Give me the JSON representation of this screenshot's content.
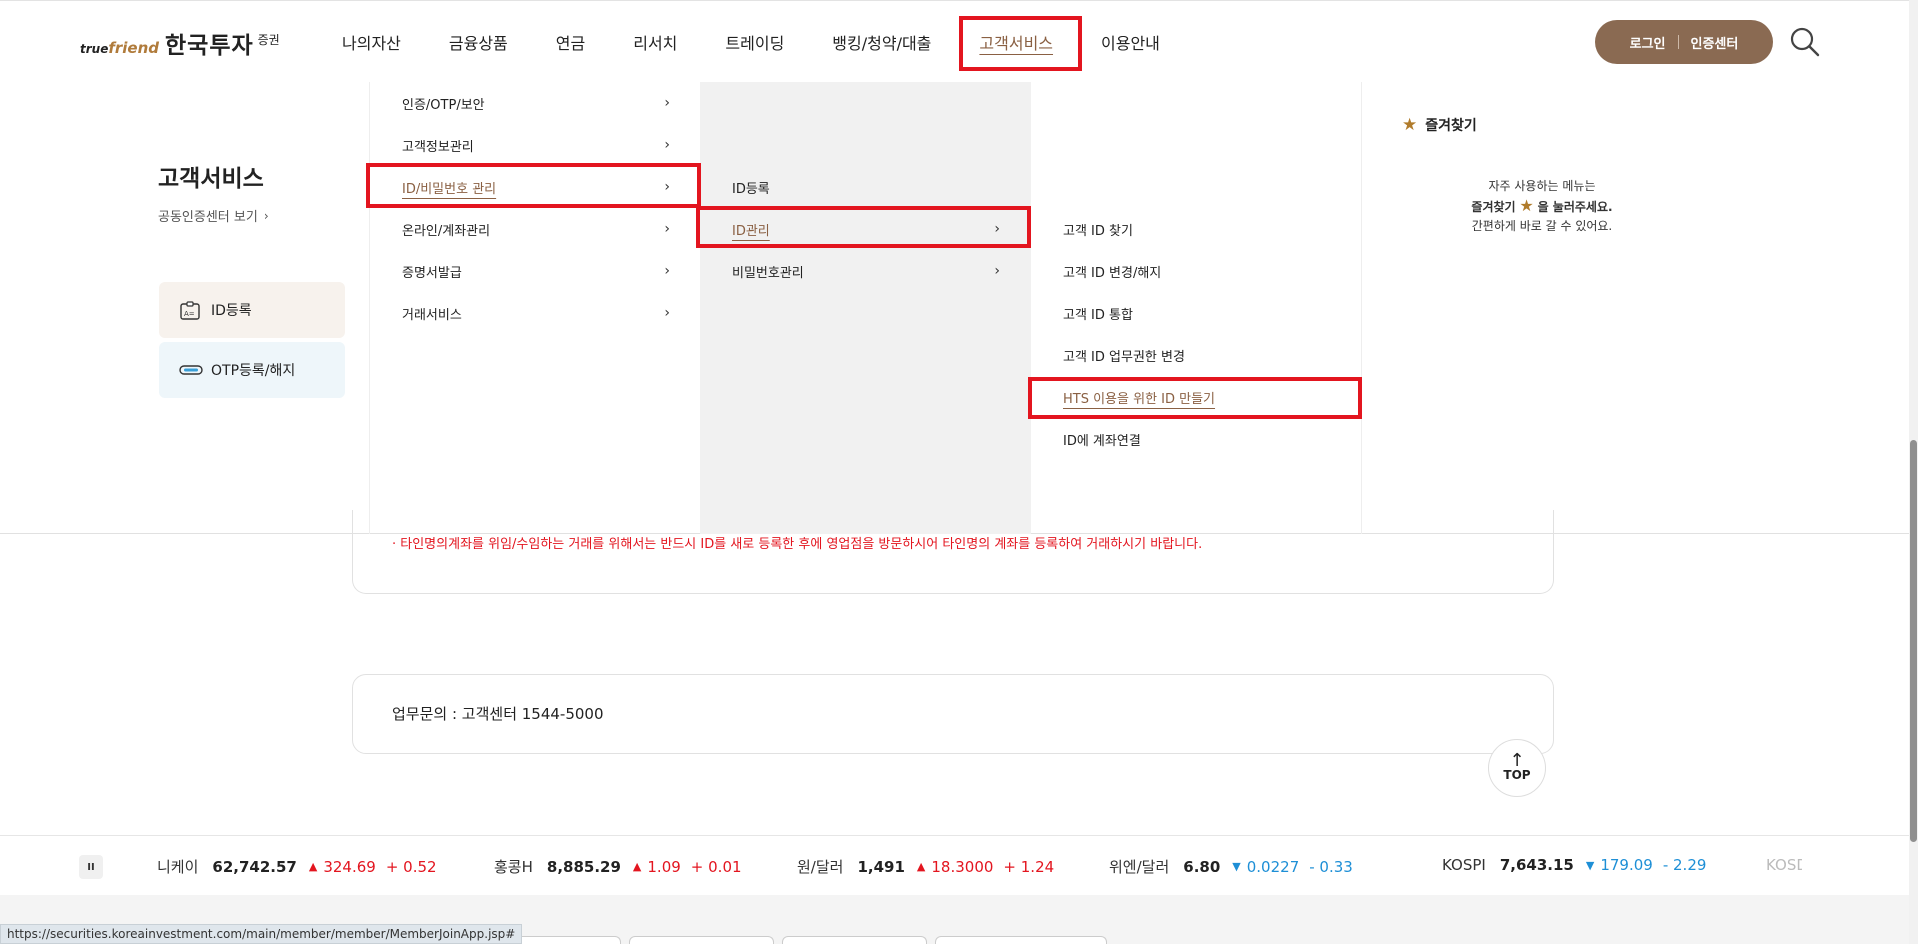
{
  "header": {
    "logo_tf": "true",
    "logo_f": "friend",
    "logo_main": "한국투자",
    "logo_sub": "증권",
    "nav": [
      "나의자산",
      "금융상품",
      "연금",
      "리서치",
      "트레이딩",
      "뱅킹/청약/대출",
      "고객서비스",
      "이용안내"
    ],
    "login": "로그인",
    "cert_center": "인증센터"
  },
  "mega": {
    "title": "고객서비스",
    "cert_link": "공동인증센터 보기",
    "quick": [
      "ID등록",
      "OTP등록/해지"
    ],
    "col1": [
      "인증/OTP/보안",
      "고객정보관리",
      "ID/비밀번호 관리",
      "온라인/계좌관리",
      "증명서발급",
      "거래서비스"
    ],
    "col2": [
      "ID등록",
      "ID관리",
      "비밀번호관리"
    ],
    "col3": [
      "고객 ID 찾기",
      "고객 ID 변경/해지",
      "고객 ID 통합",
      "고객 ID 업무권한 변경",
      "HTS 이용을 위한 ID 만들기",
      "ID에 계좌연결"
    ],
    "favorites": {
      "title": "즐겨찾기",
      "line1": "자주 사용하는 메뉴는",
      "line2a": "즐겨찾기",
      "line2b": "을 눌러주세요.",
      "line3": "간편하게 바로 갈 수 있어요."
    }
  },
  "page": {
    "notice": "· 타인명의계좌를 위임/수임하는 거래를 위해서는 반드시 ID를 새로 등록한 후에 영업점을 방문하시어 타인명의 계좌를 등록하여 거래하시기 바랍니다.",
    "contact": "업무문의 : 고객센터 1544-5000",
    "top": "TOP"
  },
  "ticker": {
    "pause": "II",
    "items": [
      {
        "name": "니케이",
        "value": "62,742.57",
        "dir": "up",
        "change": "324.69",
        "pct": "+ 0.52"
      },
      {
        "name": "홍콩H",
        "value": "8,885.29",
        "dir": "up",
        "change": "1.09",
        "pct": "+ 0.01"
      },
      {
        "name": "원/달러",
        "value": "1,491",
        "dir": "up",
        "change": "18.3000",
        "pct": "+ 1.24"
      },
      {
        "name": "위엔/달러",
        "value": "6.80",
        "dir": "down",
        "change": "0.0227",
        "pct": "- 0.33"
      },
      {
        "name": "KOSPI",
        "value": "7,643.15",
        "dir": "down",
        "change": "179.09",
        "pct": "- 2.29"
      },
      {
        "name": "KOSD",
        "value": "",
        "dir": "",
        "change": "",
        "pct": ""
      }
    ]
  },
  "status_url": "https://securities.koreainvestment.com/main/member/member/MemberJoinApp.jsp#",
  "colors": {
    "brand": "#8a6a52",
    "accent_text": "#8a6043",
    "highlight": "#e3151f",
    "down": "#1e8fd6"
  }
}
